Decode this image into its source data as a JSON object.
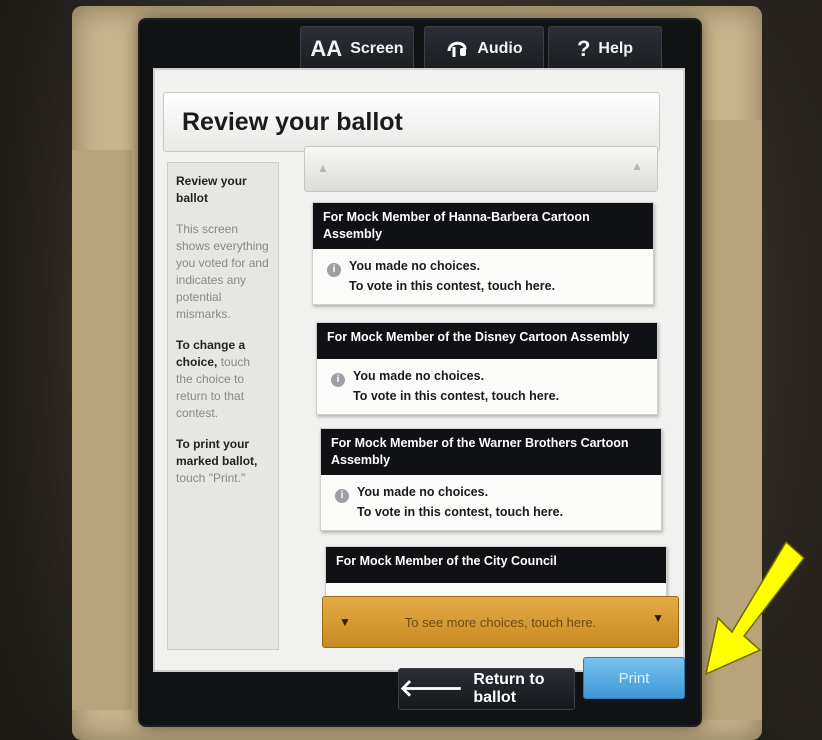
{
  "toolbar": {
    "screen_icon": "AA",
    "screen_label": "Screen",
    "audio_icon": "audio-headphone-icon",
    "audio_label": "Audio",
    "help_icon": "?",
    "help_label": "Help"
  },
  "page_title": "Review your ballot",
  "sidebar": {
    "heading": "Review your ballot",
    "description": "This screen shows everything you voted for and indicates any potential mismarks.",
    "change_bold": "To change a choice,",
    "change_rest": " touch the choice to return to that contest.",
    "print_bold": "To print your marked ballot,",
    "print_rest": " touch \"Print.\""
  },
  "contests": [
    {
      "title": "For Mock Member of Hanna-Barbera Cartoon Assembly",
      "status": "You made no choices.",
      "instruction": "To vote in this contest, touch here."
    },
    {
      "title": "For Mock Member of the Disney Cartoon Assembly",
      "status": "You made no choices.",
      "instruction": "To vote in this contest, touch here."
    },
    {
      "title": "For Mock Member of the Warner Brothers Cartoon Assembly",
      "status": "You made no choices.",
      "instruction": "To vote in this contest, touch here."
    },
    {
      "title": "For Mock Member of the City Council"
    }
  ],
  "scroll_down_label": "To see more choices, touch here.",
  "return_label": "Return to ballot",
  "print_label": "Print",
  "colors": {
    "accent_gold": "#d89a30",
    "print_blue": "#4fa6e0",
    "header_black": "#101114",
    "arrow_yellow": "#ffff00"
  }
}
